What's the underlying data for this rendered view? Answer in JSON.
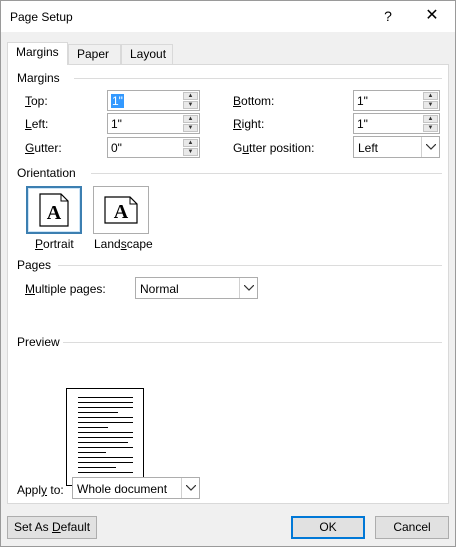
{
  "window": {
    "title": "Page Setup",
    "help_glyph": "?",
    "close_glyph": "✕"
  },
  "tabs": [
    {
      "label": "Margins",
      "active": true
    },
    {
      "label": "Paper",
      "active": false
    },
    {
      "label": "Layout",
      "active": false
    }
  ],
  "margins": {
    "section_title": "Margins",
    "top": {
      "label": "Top:",
      "mnemonic": "T",
      "rest": "op:",
      "value": "1\""
    },
    "bottom": {
      "label": "Bottom:",
      "mnemonic": "B",
      "rest": "ottom:",
      "value": "1\""
    },
    "left": {
      "label": "Left:",
      "mnemonic": "L",
      "rest": "eft:",
      "value": "1\""
    },
    "right": {
      "label": "Right:",
      "mnemonic": "R",
      "rest": "ight:",
      "value": "1\""
    },
    "gutter": {
      "label": "Gutter:",
      "mnemonic": "G",
      "rest": "utter:",
      "value": "0\""
    },
    "gutter_position": {
      "label": "Gutter position:",
      "pre": "G",
      "mnemonic": "u",
      "rest": "tter position:",
      "value": "Left"
    }
  },
  "orientation": {
    "section_title": "Orientation",
    "portrait": {
      "label": "Portrait",
      "mnemonic": "P",
      "rest": "ortrait",
      "glyph": "A",
      "selected": true
    },
    "landscape": {
      "label": "Landscape",
      "pre": "Land",
      "mnemonic": "s",
      "rest": "cape",
      "glyph": "A",
      "selected": false
    }
  },
  "pages": {
    "section_title": "Pages",
    "multiple_pages": {
      "label": "Multiple pages:",
      "mnemonic": "M",
      "rest": "ultiple pages:",
      "value": "Normal"
    }
  },
  "preview": {
    "section_title": "Preview"
  },
  "apply_to": {
    "label": "Apply to:",
    "pre": "Appl",
    "mnemonic": "y",
    "rest": " to:",
    "value": "Whole document"
  },
  "buttons": {
    "set_default": {
      "label": "Set As Default",
      "pre": "Set As ",
      "mnemonic": "D",
      "rest": "efault"
    },
    "ok": "OK",
    "cancel": "Cancel"
  },
  "colors": {
    "accent": "#0078d7",
    "selection": "#3399ff"
  }
}
